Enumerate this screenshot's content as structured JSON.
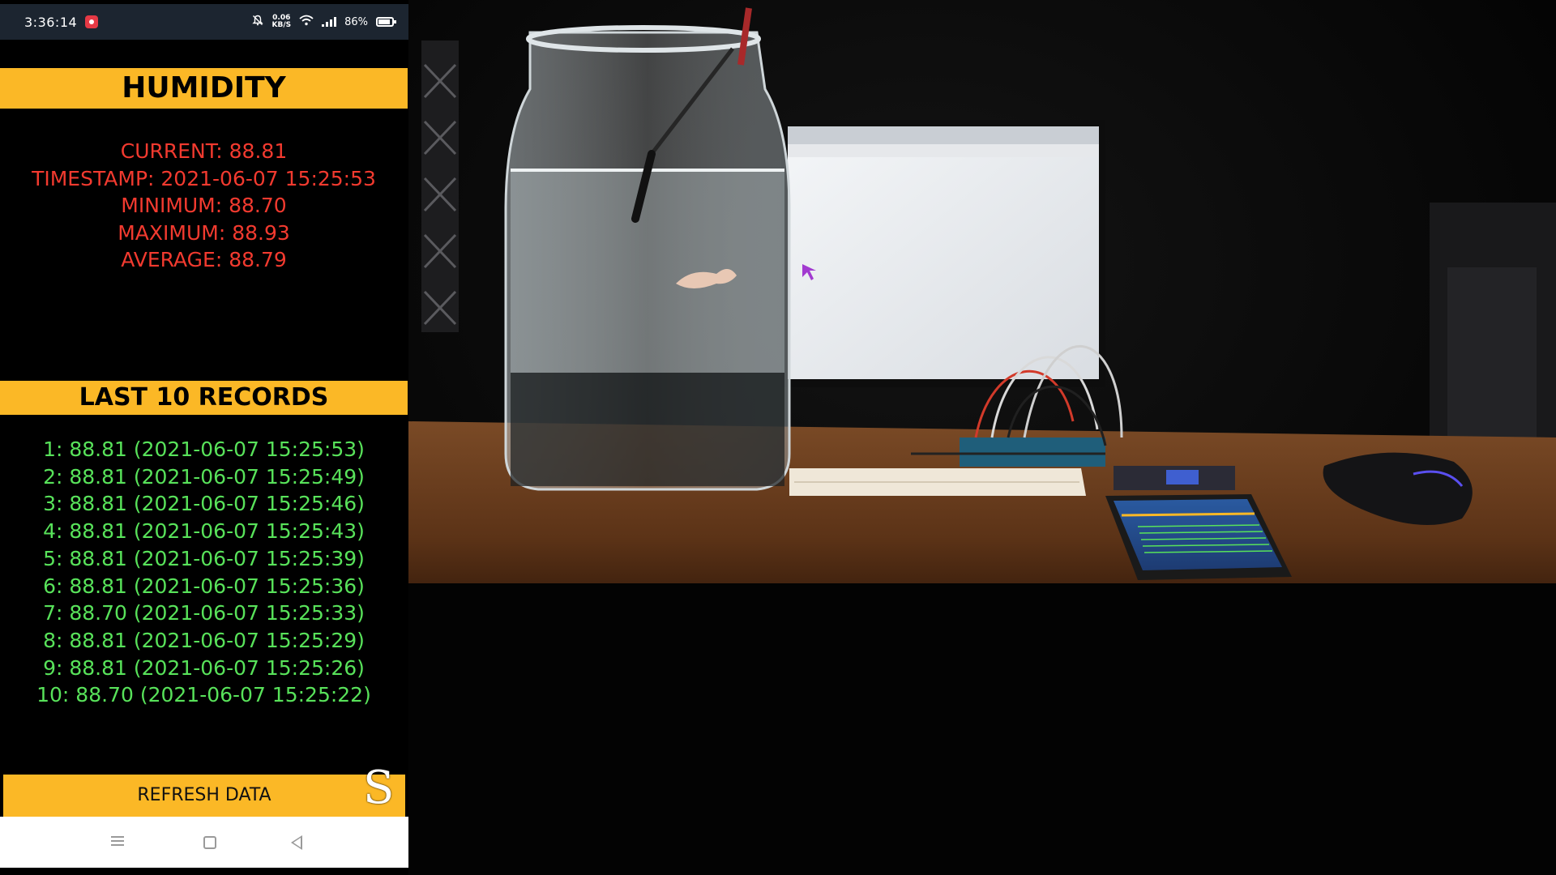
{
  "status_bar": {
    "time": "3:36:14",
    "net_speed_value": "0.06",
    "net_speed_unit": "KB/S",
    "battery": "86%",
    "icons": [
      "screen-record-icon",
      "mute-icon",
      "wifi-icon",
      "signal-icon",
      "battery-icon"
    ]
  },
  "humidity": {
    "title": "HUMIDITY",
    "current": "CURRENT: 88.81",
    "timestamp": "TIMESTAMP: 2021-06-07 15:25:53",
    "minimum": "MINIMUM: 88.70",
    "maximum": "MAXIMUM: 88.93",
    "average": "AVERAGE: 88.79"
  },
  "records": {
    "title": "LAST 10 RECORDS",
    "items": [
      "1: 88.81 (2021-06-07 15:25:53)",
      "2: 88.81 (2021-06-07 15:25:49)",
      "3: 88.81 (2021-06-07 15:25:46)",
      "4: 88.81 (2021-06-07 15:25:43)",
      "5: 88.81 (2021-06-07 15:25:39)",
      "6: 88.81 (2021-06-07 15:25:36)",
      "7: 88.70 (2021-06-07 15:25:33)",
      "8: 88.81 (2021-06-07 15:25:29)",
      "9: 88.81 (2021-06-07 15:25:26)",
      "10: 88.70 (2021-06-07 15:25:22)"
    ]
  },
  "refresh_label": "REFRESH DATA",
  "watermark": "S",
  "navigation": {
    "icons": [
      "menu-icon",
      "home-icon",
      "back-icon"
    ]
  },
  "colors": {
    "accent": "#fbb826",
    "stats_text": "#f23a2f",
    "records_text": "#58e25a",
    "status_bar_bg": "#1c2530"
  }
}
